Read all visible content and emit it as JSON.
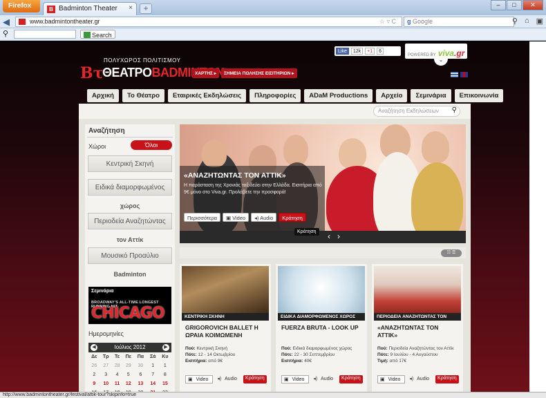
{
  "browser": {
    "menu_button": "Firefox",
    "tab_title": "Badminton Theater",
    "tab_close": "×",
    "new_tab": "+",
    "url": "www.badmintontheater.gr",
    "search_engine": "Google",
    "bookmark_search": "Search",
    "status_url": "http://www.badmintontheater.gr/festival/attik-tour?skipinfo=true"
  },
  "header": {
    "subtitle": "ΠΟΛΥΧΩΡΟΣ ΠΟΛΙΤΙΣΜΟΥ",
    "logo_part1": "ΘΕΑΤΡΟ",
    "logo_part2": "BADMINTON",
    "btn_map": "ΧΑΡΤΗΣ ▸",
    "btn_tickets": "ΣΗΜΕΙΑ ΠΩΛΗΣΗΣ ΕΙΣΙΤΗΡΙΩΝ ▸",
    "fb_like": "Like",
    "fb_count": "12k",
    "gplus": "+1",
    "gplus_count": "6",
    "powered_by": "POWERED BY",
    "powered_brand": "viva",
    "powered_brand_suffix": ".gr"
  },
  "nav": {
    "items": [
      "Αρχική",
      "Το Θέατρο",
      "Εταιρικές Εκδηλώσεις",
      "Πληροφορίες",
      "ADaM Productions",
      "Αρχείο",
      "Σεμινάρια",
      "Επικοινωνία"
    ]
  },
  "search": {
    "placeholder": "Αναζήτηση Εκδηλώσεων"
  },
  "sidebar": {
    "title": "Αναζήτηση",
    "spaces_label": "Χώροι",
    "all_button": "Όλοι",
    "venues": [
      {
        "line1": "Κεντρική Σκηνή",
        "line2": ""
      },
      {
        "line1": "Ειδικά διαμορφωμένος",
        "line2": "χώρος"
      },
      {
        "line1": "Περιοδεία Αναζητώντας",
        "line2": "τον Αττίκ"
      },
      {
        "line1": "Μουσικό Προαύλιο",
        "line2": "Badminton"
      }
    ],
    "seminars_banner_title": "Σεμινάρια",
    "seminars_banner_sub": "BROADWAY'S ALL-TIME LONGEST RUNNING HIT",
    "seminars_banner_show": "CHICAGO",
    "dates_label": "Ημερομηνίες",
    "calendar": {
      "month": "Ιούλιος 2012",
      "weekdays": [
        "Δε",
        "Τρ",
        "Τε",
        "Πε",
        "Πα",
        "Σά",
        "Κυ"
      ],
      "rows": [
        [
          "26",
          "27",
          "28",
          "29",
          "30",
          "1",
          "1"
        ],
        [
          "2",
          "3",
          "4",
          "5",
          "6",
          "7",
          "8"
        ],
        [
          "9",
          "10",
          "11",
          "12",
          "13",
          "14",
          "15"
        ],
        [
          "16",
          "17",
          "18",
          "19",
          "20",
          "21",
          "22"
        ]
      ]
    }
  },
  "slider": {
    "title": "«ΑΝΑΖΗΤΩΝΤΑΣ ΤΟΝ ΑΤΤΙΚ»",
    "text": "Η παράσταση της Χρονιάς ταξιδεύει στην Ελλάδα. Εισιτήρια από 9€ μόνο στο Viva.gr. Προλάβετε την προσφορά!",
    "btn_more": "Περισσότερα",
    "btn_video": "Video",
    "btn_audio": "Audio",
    "btn_book": "Κράτηση",
    "tooltip": "Κράτηση"
  },
  "view_toggle": "☷ ☰",
  "cards": [
    {
      "category": "ΚΕΝΤΡΙΚΗ ΣΚΗΝΗ",
      "title": "GRIGOROVICH BALLET Η ΩΡΑΙΑ ΚΟΙΜΩΜΕΝΗ",
      "where_label": "Πού:",
      "where": "Κεντρική Σκηνή",
      "when_label": "Πότε:",
      "when": "12 - 14 Οκτωβρίου",
      "tickets_label": "Εισιτήρια:",
      "tickets": "από 9€",
      "video": "Video",
      "audio": "Audio",
      "book": "Κράτηση"
    },
    {
      "category": "ΕΙΔΙΚΑ ΔΙΑΜΟΡΦΩΜΕΝΟΣ ΧΩΡΟΣ",
      "title": "FUERZA BRUTA - LOOK UP",
      "where_label": "Πού:",
      "where": "Ειδικά διαμορφωμένος χώρος",
      "when_label": "Πότε:",
      "when": "22 - 30 Σεπτεμβρίου",
      "tickets_label": "Εισιτήρια:",
      "tickets": "40€",
      "video": "Video",
      "audio": "Audio",
      "book": "Κράτηση"
    },
    {
      "category": "ΠΕΡΙΟΔΕΙΑ ΑΝΑΖΗΤΩΝΤΑΣ ΤΟΝ",
      "title": "«ΑΝΑΖΗΤΩΝΤΑΣ ΤΟΝ ΑΤΤΙΚ»",
      "where_label": "Πού:",
      "where": "Περιοδεία Αναζητώντας τον Αττίκ",
      "when_label": "Πότε:",
      "when": "9 Ιουλίου - 4 Αυγούστου",
      "tickets_label": "Τιμή:",
      "tickets": "από 17€",
      "video": "Video",
      "audio": "Audio",
      "book": "Κράτηση"
    }
  ]
}
